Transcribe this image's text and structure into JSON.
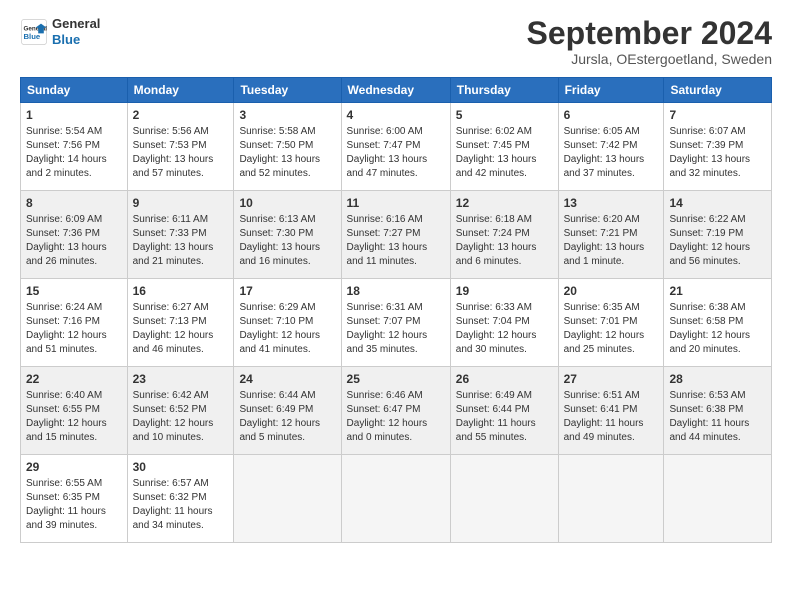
{
  "header": {
    "logo_line1": "General",
    "logo_line2": "Blue",
    "month": "September 2024",
    "location": "Jursla, OEstergoetland, Sweden"
  },
  "weekdays": [
    "Sunday",
    "Monday",
    "Tuesday",
    "Wednesday",
    "Thursday",
    "Friday",
    "Saturday"
  ],
  "rows": [
    {
      "shaded": false,
      "days": [
        {
          "num": "1",
          "lines": [
            "Sunrise: 5:54 AM",
            "Sunset: 7:56 PM",
            "Daylight: 14 hours",
            "and 2 minutes."
          ]
        },
        {
          "num": "2",
          "lines": [
            "Sunrise: 5:56 AM",
            "Sunset: 7:53 PM",
            "Daylight: 13 hours",
            "and 57 minutes."
          ]
        },
        {
          "num": "3",
          "lines": [
            "Sunrise: 5:58 AM",
            "Sunset: 7:50 PM",
            "Daylight: 13 hours",
            "and 52 minutes."
          ]
        },
        {
          "num": "4",
          "lines": [
            "Sunrise: 6:00 AM",
            "Sunset: 7:47 PM",
            "Daylight: 13 hours",
            "and 47 minutes."
          ]
        },
        {
          "num": "5",
          "lines": [
            "Sunrise: 6:02 AM",
            "Sunset: 7:45 PM",
            "Daylight: 13 hours",
            "and 42 minutes."
          ]
        },
        {
          "num": "6",
          "lines": [
            "Sunrise: 6:05 AM",
            "Sunset: 7:42 PM",
            "Daylight: 13 hours",
            "and 37 minutes."
          ]
        },
        {
          "num": "7",
          "lines": [
            "Sunrise: 6:07 AM",
            "Sunset: 7:39 PM",
            "Daylight: 13 hours",
            "and 32 minutes."
          ]
        }
      ]
    },
    {
      "shaded": true,
      "days": [
        {
          "num": "8",
          "lines": [
            "Sunrise: 6:09 AM",
            "Sunset: 7:36 PM",
            "Daylight: 13 hours",
            "and 26 minutes."
          ]
        },
        {
          "num": "9",
          "lines": [
            "Sunrise: 6:11 AM",
            "Sunset: 7:33 PM",
            "Daylight: 13 hours",
            "and 21 minutes."
          ]
        },
        {
          "num": "10",
          "lines": [
            "Sunrise: 6:13 AM",
            "Sunset: 7:30 PM",
            "Daylight: 13 hours",
            "and 16 minutes."
          ]
        },
        {
          "num": "11",
          "lines": [
            "Sunrise: 6:16 AM",
            "Sunset: 7:27 PM",
            "Daylight: 13 hours",
            "and 11 minutes."
          ]
        },
        {
          "num": "12",
          "lines": [
            "Sunrise: 6:18 AM",
            "Sunset: 7:24 PM",
            "Daylight: 13 hours",
            "and 6 minutes."
          ]
        },
        {
          "num": "13",
          "lines": [
            "Sunrise: 6:20 AM",
            "Sunset: 7:21 PM",
            "Daylight: 13 hours",
            "and 1 minute."
          ]
        },
        {
          "num": "14",
          "lines": [
            "Sunrise: 6:22 AM",
            "Sunset: 7:19 PM",
            "Daylight: 12 hours",
            "and 56 minutes."
          ]
        }
      ]
    },
    {
      "shaded": false,
      "days": [
        {
          "num": "15",
          "lines": [
            "Sunrise: 6:24 AM",
            "Sunset: 7:16 PM",
            "Daylight: 12 hours",
            "and 51 minutes."
          ]
        },
        {
          "num": "16",
          "lines": [
            "Sunrise: 6:27 AM",
            "Sunset: 7:13 PM",
            "Daylight: 12 hours",
            "and 46 minutes."
          ]
        },
        {
          "num": "17",
          "lines": [
            "Sunrise: 6:29 AM",
            "Sunset: 7:10 PM",
            "Daylight: 12 hours",
            "and 41 minutes."
          ]
        },
        {
          "num": "18",
          "lines": [
            "Sunrise: 6:31 AM",
            "Sunset: 7:07 PM",
            "Daylight: 12 hours",
            "and 35 minutes."
          ]
        },
        {
          "num": "19",
          "lines": [
            "Sunrise: 6:33 AM",
            "Sunset: 7:04 PM",
            "Daylight: 12 hours",
            "and 30 minutes."
          ]
        },
        {
          "num": "20",
          "lines": [
            "Sunrise: 6:35 AM",
            "Sunset: 7:01 PM",
            "Daylight: 12 hours",
            "and 25 minutes."
          ]
        },
        {
          "num": "21",
          "lines": [
            "Sunrise: 6:38 AM",
            "Sunset: 6:58 PM",
            "Daylight: 12 hours",
            "and 20 minutes."
          ]
        }
      ]
    },
    {
      "shaded": true,
      "days": [
        {
          "num": "22",
          "lines": [
            "Sunrise: 6:40 AM",
            "Sunset: 6:55 PM",
            "Daylight: 12 hours",
            "and 15 minutes."
          ]
        },
        {
          "num": "23",
          "lines": [
            "Sunrise: 6:42 AM",
            "Sunset: 6:52 PM",
            "Daylight: 12 hours",
            "and 10 minutes."
          ]
        },
        {
          "num": "24",
          "lines": [
            "Sunrise: 6:44 AM",
            "Sunset: 6:49 PM",
            "Daylight: 12 hours",
            "and 5 minutes."
          ]
        },
        {
          "num": "25",
          "lines": [
            "Sunrise: 6:46 AM",
            "Sunset: 6:47 PM",
            "Daylight: 12 hours",
            "and 0 minutes."
          ]
        },
        {
          "num": "26",
          "lines": [
            "Sunrise: 6:49 AM",
            "Sunset: 6:44 PM",
            "Daylight: 11 hours",
            "and 55 minutes."
          ]
        },
        {
          "num": "27",
          "lines": [
            "Sunrise: 6:51 AM",
            "Sunset: 6:41 PM",
            "Daylight: 11 hours",
            "and 49 minutes."
          ]
        },
        {
          "num": "28",
          "lines": [
            "Sunrise: 6:53 AM",
            "Sunset: 6:38 PM",
            "Daylight: 11 hours",
            "and 44 minutes."
          ]
        }
      ]
    },
    {
      "shaded": false,
      "days": [
        {
          "num": "29",
          "lines": [
            "Sunrise: 6:55 AM",
            "Sunset: 6:35 PM",
            "Daylight: 11 hours",
            "and 39 minutes."
          ]
        },
        {
          "num": "30",
          "lines": [
            "Sunrise: 6:57 AM",
            "Sunset: 6:32 PM",
            "Daylight: 11 hours",
            "and 34 minutes."
          ]
        },
        null,
        null,
        null,
        null,
        null
      ]
    }
  ]
}
